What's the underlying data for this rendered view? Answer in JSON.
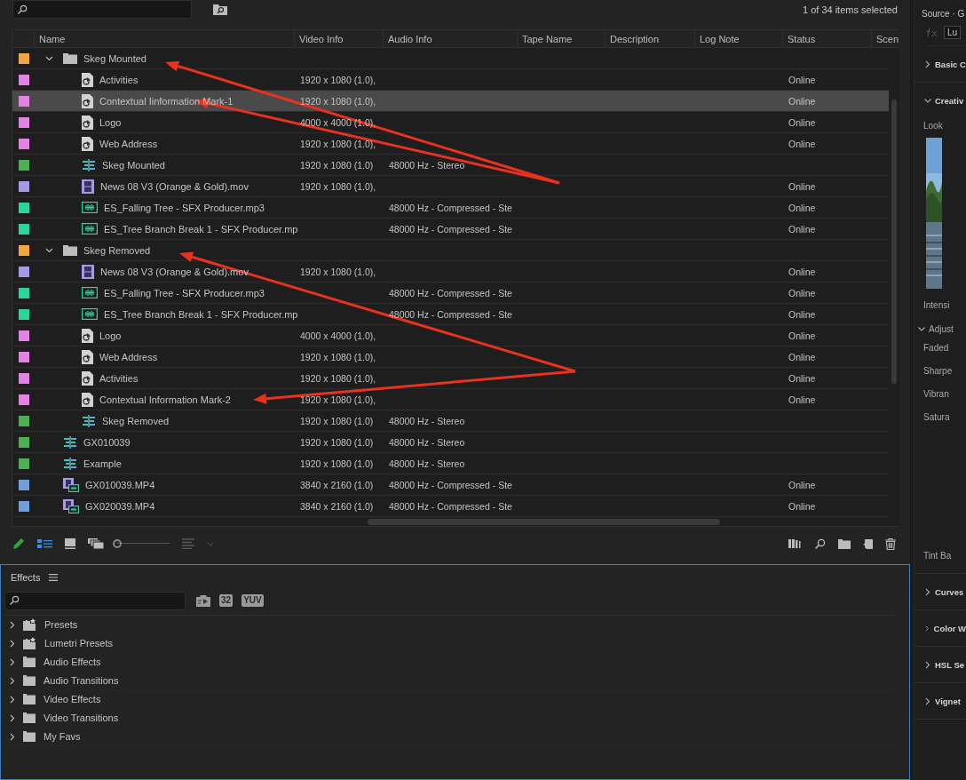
{
  "project": {
    "selection_count": "1 of 34 items selected",
    "columns": [
      "Name",
      "Video Info",
      "Audio Info",
      "Tape Name",
      "Description",
      "Log Note",
      "Status",
      "Scen"
    ],
    "rows": [
      {
        "kind": "folder",
        "name": "Skeg Mounted",
        "color": "#f2a541",
        "expanded": true,
        "selected": false,
        "children": [
          {
            "kind": "graphic",
            "name": "Activities",
            "video": "1920 x 1080 (1.0),",
            "status": "Online",
            "color": "#e582e4",
            "selected": false
          },
          {
            "kind": "graphic",
            "name": "Contextual Iinformation Mark-1",
            "video": "1920 x 1080 (1.0),",
            "status": "Online",
            "color": "#e582e4",
            "selected": true
          },
          {
            "kind": "graphic",
            "name": "Logo",
            "video": "4000 x 4000 (1.0),",
            "status": "Online",
            "color": "#e582e4",
            "selected": false
          },
          {
            "kind": "graphic",
            "name": "Web Address",
            "video": "1920 x 1080 (1.0),",
            "status": "Online",
            "color": "#e582e4",
            "selected": false
          },
          {
            "kind": "sequence",
            "name": "Skeg Mounted",
            "video": "1920 x 1080 (1.0)",
            "audio": "48000 Hz - Stereo",
            "color": "#4bb152",
            "selected": false
          },
          {
            "kind": "video",
            "name": "News 08 V3 (Orange & Gold).mov",
            "video": "1920 x 1080 (1.0),",
            "status": "Online",
            "color": "#a898e8",
            "selected": false
          },
          {
            "kind": "audio",
            "name": "ES_Falling Tree - SFX Producer.mp3",
            "audio": "48000 Hz - Compressed - Ste",
            "status": "Online",
            "color": "#2bd49b",
            "selected": false
          },
          {
            "kind": "audio",
            "name": "ES_Tree Branch Break 1 - SFX Producer.mp",
            "audio": "48000 Hz - Compressed - Ste",
            "status": "Online",
            "color": "#2bd49b",
            "selected": false
          }
        ]
      },
      {
        "kind": "folder",
        "name": "Skeg Removed",
        "color": "#f2a541",
        "expanded": true,
        "selected": false,
        "children": [
          {
            "kind": "video",
            "name": "News 08 V3 (Orange & Gold).mov",
            "video": "1920 x 1080 (1.0),",
            "status": "Online",
            "color": "#a898e8",
            "selected": false
          },
          {
            "kind": "audio",
            "name": "ES_Falling Tree - SFX Producer.mp3",
            "audio": "48000 Hz - Compressed - Ste",
            "status": "Online",
            "color": "#2bd49b",
            "selected": false
          },
          {
            "kind": "audio",
            "name": "ES_Tree Branch Break 1 - SFX Producer.mp",
            "audio": "48000 Hz - Compressed - Ste",
            "status": "Online",
            "color": "#2bd49b",
            "selected": false
          },
          {
            "kind": "graphic",
            "name": "Logo",
            "video": "4000 x 4000 (1.0),",
            "status": "Online",
            "color": "#e582e4",
            "selected": false
          },
          {
            "kind": "graphic",
            "name": "Web Address",
            "video": "1920 x 1080 (1.0),",
            "status": "Online",
            "color": "#e582e4",
            "selected": false
          },
          {
            "kind": "graphic",
            "name": "Activities",
            "video": "1920 x 1080 (1.0),",
            "status": "Online",
            "color": "#e582e4",
            "selected": false
          },
          {
            "kind": "graphic",
            "name": "Contextual Information Mark-2",
            "video": "1920 x 1080 (1.0),",
            "status": "Online",
            "color": "#e582e4",
            "selected": false
          },
          {
            "kind": "sequence",
            "name": "Skeg Removed",
            "video": "1920 x 1080 (1.0)",
            "audio": "48000 Hz - Stereo",
            "color": "#4bb152",
            "selected": false
          }
        ]
      },
      {
        "kind": "sequence",
        "name": "GX010039",
        "video": "1920 x 1080 (1.0)",
        "audio": "48000 Hz - Stereo",
        "color": "#4bb152",
        "selected": false
      },
      {
        "kind": "sequence",
        "name": "Example",
        "video": "1920 x 1080 (1.0)",
        "audio": "48000 Hz - Stereo",
        "color": "#4bb152",
        "selected": false
      },
      {
        "kind": "clip",
        "name": "GX010039.MP4",
        "video": "3840 x 2160 (1.0)",
        "audio": "48000 Hz - Compressed - Ste",
        "status": "Online",
        "color": "#6f9fdc",
        "selected": false
      },
      {
        "kind": "clip",
        "name": "GX020039.MP4",
        "video": "3840 x 2160 (1.0)",
        "audio": "48000 Hz - Compressed - Ste",
        "status": "Online",
        "color": "#6f9fdc",
        "selected": false
      }
    ]
  },
  "toolbar": {
    "views": [
      {
        "kind": "list",
        "selected": true
      },
      {
        "kind": "icon",
        "selected": false
      },
      {
        "kind": "freeform",
        "selected": false
      }
    ],
    "zoom": {
      "level": 0
    }
  },
  "effects": {
    "title": "Effects",
    "badges": [
      "32",
      "YUV"
    ],
    "items": [
      {
        "kind": "preset_folder",
        "label": "Presets",
        "expanded": false
      },
      {
        "kind": "preset_folder",
        "label": "Lumetri Presets",
        "expanded": false
      },
      {
        "kind": "folder",
        "label": "Audio Effects",
        "expanded": false
      },
      {
        "kind": "folder",
        "label": "Audio Transitions",
        "expanded": false
      },
      {
        "kind": "folder",
        "label": "Video Effects",
        "expanded": false
      },
      {
        "kind": "folder",
        "label": "Video Transitions",
        "expanded": false
      },
      {
        "kind": "folder",
        "label": "My Favs",
        "expanded": false
      }
    ]
  },
  "lumetri": {
    "title": "Source · G",
    "fx_field": "Lu",
    "sections": [
      {
        "title": "Basic C",
        "expanded": false
      },
      {
        "title": "Creativ",
        "expanded": true,
        "items": [
          {
            "kind": "label",
            "text": "Look"
          },
          {
            "kind": "picture"
          },
          {
            "kind": "label",
            "text": "Intensi"
          },
          {
            "kind": "group",
            "title": "Adjust",
            "expanded": true,
            "items": [
              "Faded",
              "Sharpe",
              "Vibran",
              "Satura",
              "Tint Ba"
            ]
          }
        ]
      },
      {
        "title": "Curves",
        "expanded": false
      },
      {
        "title": "Color W",
        "expanded": false
      },
      {
        "title": "HSL Se",
        "expanded": false
      },
      {
        "title": "Vignet",
        "expanded": false
      }
    ]
  },
  "annotations": [
    {
      "kind": "arrow"
    },
    {
      "kind": "arrow"
    },
    {
      "kind": "arrow"
    },
    {
      "kind": "arrow"
    }
  ]
}
